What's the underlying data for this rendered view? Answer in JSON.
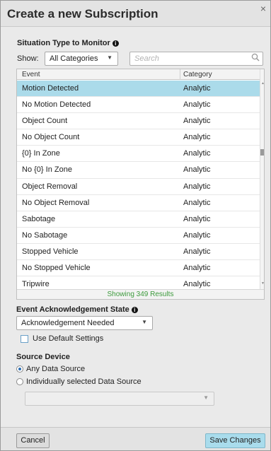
{
  "dialog": {
    "title": "Create a new Subscription",
    "close": "×"
  },
  "situation": {
    "heading": "Situation Type to Monitor",
    "info_icon": "i",
    "show_label": "Show:",
    "category_filter": "All Categories",
    "search_placeholder": "Search"
  },
  "table": {
    "columns": [
      "Event",
      "Category"
    ],
    "rows": [
      {
        "event": "Motion Detected",
        "category": "Analytic",
        "selected": true
      },
      {
        "event": "No Motion Detected",
        "category": "Analytic"
      },
      {
        "event": "Object Count",
        "category": "Analytic"
      },
      {
        "event": "No Object Count",
        "category": "Analytic"
      },
      {
        "event": "{0} In Zone",
        "category": "Analytic"
      },
      {
        "event": "No {0} In Zone",
        "category": "Analytic"
      },
      {
        "event": "Object Removal",
        "category": "Analytic"
      },
      {
        "event": "No Object Removal",
        "category": "Analytic"
      },
      {
        "event": "Sabotage",
        "category": "Analytic"
      },
      {
        "event": "No Sabotage",
        "category": "Analytic"
      },
      {
        "event": "Stopped Vehicle",
        "category": "Analytic"
      },
      {
        "event": "No Stopped Vehicle",
        "category": "Analytic"
      },
      {
        "event": "Tripwire",
        "category": "Analytic"
      }
    ],
    "results_text": "Showing 349 Results"
  },
  "ack": {
    "heading": "Event Acknowledgement State",
    "info_icon": "i",
    "value": "Acknowledgement Needed",
    "default_label": "Use Default Settings"
  },
  "source": {
    "heading": "Source Device",
    "any_label": "Any Data Source",
    "individual_label": "Individually selected Data Source",
    "device_value": ""
  },
  "footer": {
    "cancel": "Cancel",
    "save": "Save Changes"
  },
  "colors": {
    "selected_row": "#abdbea",
    "save_button": "#a9dcec",
    "results_text": "#3c9a3c"
  }
}
